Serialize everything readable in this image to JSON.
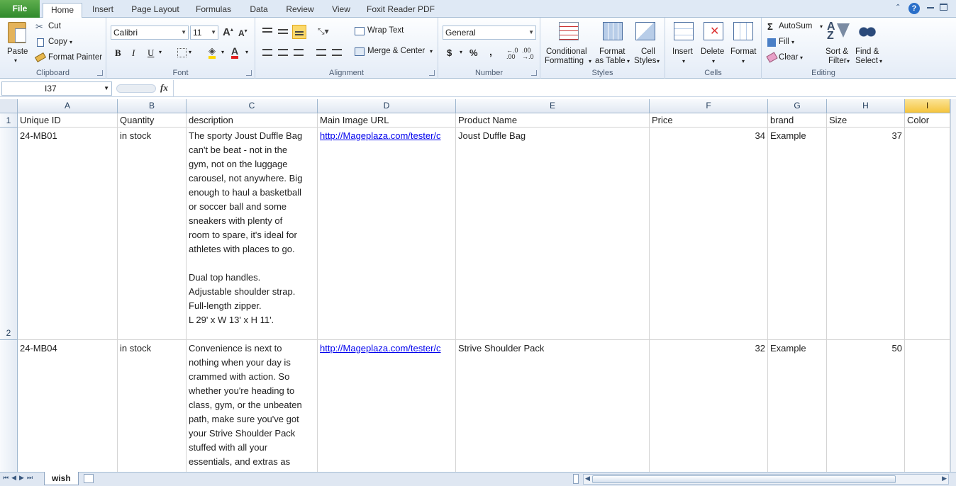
{
  "tabs": {
    "file": "File",
    "items": [
      "Home",
      "Insert",
      "Page Layout",
      "Formulas",
      "Data",
      "Review",
      "View",
      "Foxit Reader PDF"
    ],
    "active": "Home"
  },
  "clipboard": {
    "paste": "Paste",
    "cut": "Cut",
    "copy": "Copy",
    "format_painter": "Format Painter",
    "label": "Clipboard"
  },
  "font": {
    "name": "Calibri",
    "size": "11",
    "bold": "B",
    "italic": "I",
    "underline": "U",
    "font_color_letter": "A",
    "label": "Font"
  },
  "alignment": {
    "wrap_text": "Wrap Text",
    "merge_center": "Merge & Center",
    "label": "Alignment"
  },
  "number": {
    "format": "General",
    "currency": "$",
    "percent": "%",
    "comma": ",",
    "label": "Number"
  },
  "styles": {
    "conditional": "Conditional",
    "conditional2": "Formatting",
    "format_table": "Format",
    "format_table2": "as Table",
    "cell_styles": "Cell",
    "cell_styles2": "Styles",
    "label": "Styles"
  },
  "cells": {
    "insert": "Insert",
    "delete": "Delete",
    "format": "Format",
    "label": "Cells"
  },
  "editing": {
    "autosum": "AutoSum",
    "fill": "Fill",
    "clear": "Clear",
    "sort": "Sort &",
    "sort2": "Filter",
    "find": "Find &",
    "find2": "Select",
    "label": "Editing"
  },
  "formula_bar": {
    "name_box": "I37",
    "fx": "fx",
    "content": ""
  },
  "columns": [
    "A",
    "B",
    "C",
    "D",
    "E",
    "F",
    "G",
    "H",
    "I"
  ],
  "selected_column": "I",
  "row_numbers": [
    "1",
    "2",
    ""
  ],
  "headers": [
    "Unique ID",
    "Quantity",
    "description",
    "Main Image URL",
    "Product Name",
    "Price",
    "brand",
    "Size",
    "Color"
  ],
  "rows": [
    {
      "id": "24-MB01",
      "quantity": "in stock",
      "description": "The sporty Joust Duffle Bag\ncan't be beat - not in the\ngym, not on the luggage\ncarousel, not anywhere. Big\nenough to haul a basketball\nor soccer ball and some\nsneakers with plenty of\nroom to spare, it's ideal for\nathletes with places to go.\n\nDual top handles.\nAdjustable shoulder strap.\nFull-length zipper.\nL 29' x W 13' x H 11'.",
      "url": "http://Mageplaza.com/tester/c",
      "product": "Joust Duffle Bag",
      "price": "34",
      "brand": "Example",
      "size": "37",
      "color": ""
    },
    {
      "id": "24-MB04",
      "quantity": "in stock",
      "description": "Convenience is next to\nnothing when your day is\ncrammed with action. So\nwhether you're heading to\nclass, gym, or the unbeaten\npath, make sure you've got\nyour Strive Shoulder Pack\nstuffed with all your\nessentials, and extras as\nwell.",
      "url": "http://Mageplaza.com/tester/c",
      "product": "Strive Shoulder Pack",
      "price": "32",
      "brand": "Example",
      "size": "50",
      "color": ""
    }
  ],
  "sheet_tabs": {
    "active": "wish"
  },
  "colors": {
    "accent": "#2f8a2c",
    "selected_header": "#f5c43c",
    "link": "#0000ee"
  }
}
